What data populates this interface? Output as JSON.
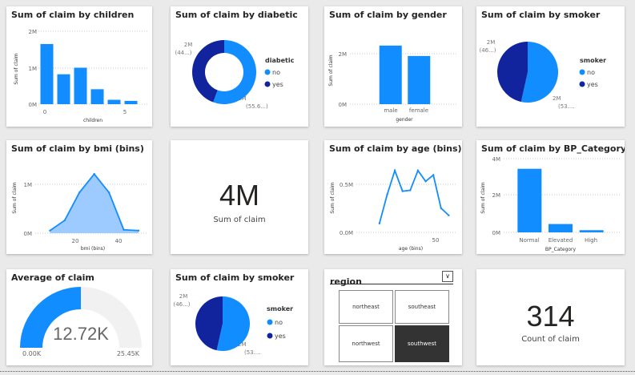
{
  "colors": {
    "primary": "#118dff",
    "dark": "#12239e",
    "light_fill": "#9ecbff",
    "gauge_bg": "#f1f1f1"
  },
  "visuals": {
    "children": {
      "title": "Sum of claim by children",
      "ylabel": "Sum of claim",
      "xlabel": "children",
      "y_ticks": [
        "2M",
        "1M",
        "0M"
      ],
      "x_ticks": [
        "0",
        "5"
      ]
    },
    "diabetic": {
      "title": "Sum of claim by diabetic",
      "legend_title": "diabetic",
      "legend": [
        "no",
        "yes"
      ],
      "label_left": [
        "2M",
        "(44...)"
      ],
      "label_right": [
        "2M",
        "(55.6...)"
      ]
    },
    "gender": {
      "title": "Sum of claim by gender",
      "ylabel": "Sum of claim",
      "xlabel": "gender",
      "y_ticks": [
        "2M",
        "0M"
      ],
      "x_ticks": [
        "male",
        "female"
      ]
    },
    "smoker1": {
      "title": "Sum of claim by smoker",
      "legend_title": "smoker",
      "legend": [
        "no",
        "yes"
      ],
      "label_left": [
        "2M",
        "(46...)"
      ],
      "label_right": [
        "2M",
        "(53...."
      ]
    },
    "bmi": {
      "title": "Sum of claim by bmi (bins)",
      "ylabel": "Sum of claim",
      "xlabel": "bmi (bins)",
      "y_ticks": [
        "1M",
        "0M"
      ],
      "x_ticks": [
        "20",
        "40"
      ]
    },
    "card_sum": {
      "value": "4M",
      "label": "Sum of claim"
    },
    "age": {
      "title": "Sum of claim by age (bins)",
      "ylabel": "Sum of claim",
      "xlabel": "age (bins)",
      "y_ticks": [
        "0.5M",
        "0.0M"
      ],
      "x_ticks": [
        "50"
      ]
    },
    "bp": {
      "title": "Sum of claim by BP_Category",
      "ylabel": "Sum of claim",
      "xlabel": "BP_Category",
      "y_ticks": [
        "4M",
        "2M",
        "0M"
      ],
      "x_ticks": [
        "Normal",
        "Elevated",
        "High"
      ]
    },
    "gauge": {
      "title": "Average of claim",
      "value": "12.72K",
      "min": "0.00K",
      "max": "25.45K",
      "fraction": 0.5
    },
    "smoker2": {
      "title": "Sum of claim by smoker",
      "legend_title": "smoker",
      "legend": [
        "no",
        "yes"
      ],
      "label_left": [
        "2M",
        "(46...)"
      ],
      "label_right": [
        "2M",
        "(53...."
      ]
    },
    "slicer": {
      "title": "region",
      "options": [
        "northeast",
        "southeast",
        "northwest",
        "southwest"
      ],
      "selected": "southwest"
    },
    "card_count": {
      "value": "314",
      "label": "Count of claim"
    }
  },
  "chart_data": [
    {
      "type": "bar",
      "title": "Sum of claim by children",
      "categories": [
        "0",
        "1",
        "2",
        "3",
        "4",
        "5"
      ],
      "values": [
        1650000,
        820000,
        1000000,
        410000,
        120000,
        90000
      ],
      "ylim": [
        0,
        2000000
      ],
      "xlabel": "children",
      "ylabel": "Sum of claim"
    },
    {
      "type": "pie",
      "title": "Sum of claim by diabetic",
      "donut": true,
      "categories": [
        "no",
        "yes"
      ],
      "values": [
        55.6,
        44.4
      ]
    },
    {
      "type": "bar",
      "title": "Sum of claim by gender",
      "categories": [
        "male",
        "female"
      ],
      "values": [
        2250000,
        1850000
      ],
      "ylim": [
        0,
        2800000
      ],
      "xlabel": "gender",
      "ylabel": "Sum of claim"
    },
    {
      "type": "pie",
      "title": "Sum of claim by smoker",
      "categories": [
        "no",
        "yes"
      ],
      "values": [
        53.5,
        46.5
      ]
    },
    {
      "type": "area",
      "title": "Sum of claim by bmi (bins)",
      "x": [
        15,
        20,
        25,
        30,
        35,
        40,
        45
      ],
      "values": [
        60000,
        300000,
        950000,
        1380000,
        950000,
        80000,
        60000
      ],
      "xlim": [
        10,
        48
      ],
      "ylim": [
        0,
        1700000
      ],
      "xlabel": "bmi (bins)",
      "ylabel": "Sum of claim"
    },
    {
      "type": "line",
      "title": "Sum of claim by age (bins)",
      "x": [
        15,
        20,
        25,
        30,
        35,
        40,
        45,
        50,
        55,
        60
      ],
      "values": [
        100000,
        420000,
        690000,
        460000,
        470000,
        690000,
        570000,
        640000,
        270000,
        190000
      ],
      "xlim": [
        0,
        65
      ],
      "ylim": [
        0,
        850000
      ],
      "xlabel": "age (bins)",
      "ylabel": "Sum of claim"
    },
    {
      "type": "bar",
      "title": "Sum of claim by BP_Category",
      "categories": [
        "Normal",
        "Elevated",
        "High"
      ],
      "values": [
        3500000,
        460000,
        120000
      ],
      "ylim": [
        0,
        4500000
      ],
      "xlabel": "BP_Category",
      "ylabel": "Sum of claim"
    },
    {
      "type": "pie",
      "title": "Sum of claim by smoker",
      "categories": [
        "no",
        "yes"
      ],
      "values": [
        53.5,
        46.5
      ]
    }
  ]
}
